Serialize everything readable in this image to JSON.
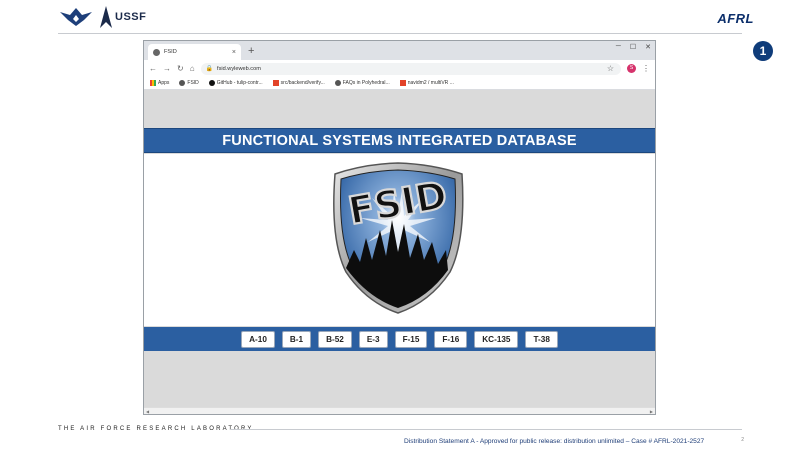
{
  "slide": {
    "brand_left": "USSF",
    "brand_right": "AFRL",
    "slide_badge": "1",
    "footer_lab": "THE AIR FORCE RESEARCH LABORATORY",
    "footer_statement": "Distribution Statement A - Approved for public release: distribution unlimited – Case # AFRL-2021-2527",
    "page_number": "2"
  },
  "browser": {
    "tab_title": "FSID",
    "tab_close": "×",
    "new_tab": "+",
    "url": "fsid.wyleweb.com",
    "bookmarks": [
      {
        "label": "Apps"
      },
      {
        "label": "FSID"
      },
      {
        "label": "GitHub - tulip-contr..."
      },
      {
        "label": "src/backend/verify..."
      },
      {
        "label": "FAQs in Polyhedral..."
      },
      {
        "label": "navidm2 / multiVR ..."
      }
    ],
    "profile_initial": "S"
  },
  "page": {
    "title": "FUNCTIONAL SYSTEMS INTEGRATED DATABASE",
    "logo_text": "FSID",
    "aircraft": [
      "A-10",
      "B-1",
      "B-52",
      "E-3",
      "F-15",
      "F-16",
      "KC-135",
      "T-38"
    ]
  },
  "colors": {
    "band_blue": "#2b5fa1",
    "afrl_navy": "#0c2f6b",
    "badge_navy": "#0f3c7a"
  }
}
